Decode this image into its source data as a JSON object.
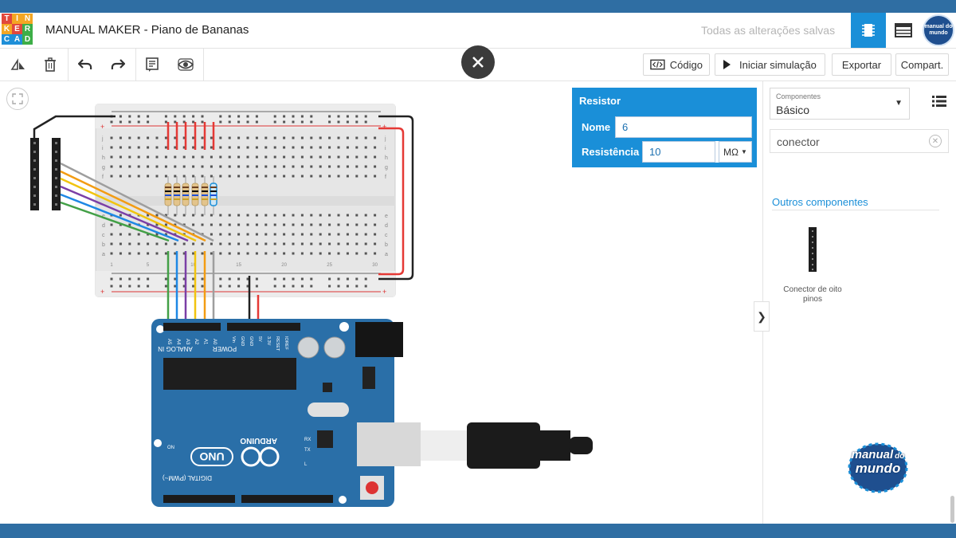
{
  "app": {
    "logo_letters": [
      "T",
      "I",
      "N",
      "K",
      "E",
      "R",
      "C",
      "A",
      "D"
    ],
    "logo_colors": [
      "#e1483c",
      "#f4a623",
      "#f4a623",
      "#f4a623",
      "#e1483c",
      "#3dae47",
      "#1f8fd8",
      "#1f8fd8",
      "#3dae47"
    ],
    "project_title": "MANUAL MAKER - Piano de Bananas",
    "save_status": "Todas as alterações salvas",
    "avatar_text": "manual do mundo"
  },
  "header": {
    "circuit_view_icon": "breadboard-chip-icon",
    "schematic_view_icon": "table-list-icon"
  },
  "toolbar": {
    "rotate_icon": "rotate-icon",
    "delete_icon": "trash-icon",
    "undo_icon": "undo-icon",
    "redo_icon": "redo-icon",
    "notes_icon": "notes-icon",
    "visibility_icon": "eye-icon",
    "code_label": "Código",
    "simulate_label": "Iniciar simulação",
    "export_label": "Exportar",
    "share_label": "Compart."
  },
  "inspector": {
    "title": "Resistor",
    "name_label": "Nome",
    "name_value": "6",
    "resistance_label": "Resistência",
    "resistance_value": "10",
    "unit": "MΩ"
  },
  "sidebar": {
    "category_label": "Componentes",
    "category_value": "Básico",
    "search_value": "conector",
    "other_title": "Outros componentes",
    "component_name": "Conector de oito pinos"
  },
  "board": {
    "brand": "ARDUINO",
    "model": "UNO",
    "analog_label": "ANALOG IN",
    "power_label": "POWER",
    "digital_label": "DIGITAL (PWM~)",
    "on_label": "ON",
    "tx_label": "TX",
    "rx_label": "RX",
    "l_label": "L",
    "analog_pins": [
      "A5",
      "A4",
      "A3",
      "A2",
      "A1",
      "A0"
    ],
    "power_pins": [
      "Vin",
      "GND",
      "GND",
      "5V",
      "3.3V",
      "RESET",
      "IOREF"
    ]
  },
  "breadboard": {
    "row_letters_top": [
      "j",
      "i",
      "h",
      "g",
      "f"
    ],
    "row_letters_bottom": [
      "e",
      "d",
      "c",
      "b",
      "a"
    ],
    "col_numbers": [
      "1",
      "5",
      "10",
      "15",
      "20",
      "25",
      "30"
    ]
  },
  "watermark": {
    "line1": "manual",
    "line2": "do",
    "line3": "mundo"
  },
  "colors": {
    "accent": "#1a8fd8",
    "band": "#2f6ea3",
    "arduino": "#2a6fa8",
    "wire_red": "#e53935",
    "wire_black": "#222222",
    "wire_orange": "#f39c12",
    "wire_yellow": "#f1c40f",
    "wire_purple": "#7b3fa6",
    "wire_blue": "#1e88e5",
    "wire_green": "#43a047",
    "wire_gray": "#9e9e9e"
  }
}
